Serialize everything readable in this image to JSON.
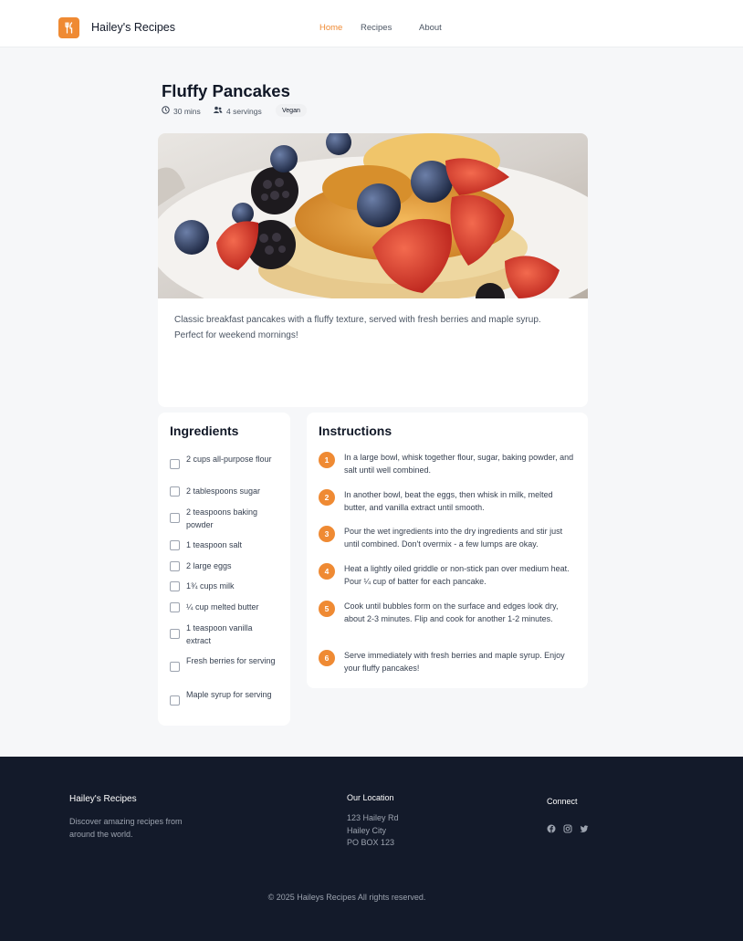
{
  "header": {
    "brand": "Hailey's Recipes",
    "nav": [
      "Home",
      "Recipes",
      "About"
    ],
    "accent_color": "#ef8a33",
    "logo_icon": "fork-knife-icon"
  },
  "recipe": {
    "title": "Fluffy Pancakes",
    "time": "30 mins",
    "servings": "4 servings",
    "tag": "Vegan",
    "description": "Classic breakfast pancakes with a fluffy texture, served with fresh berries and maple syrup. Perfect for weekend mornings!"
  },
  "ingredients": {
    "heading": "Ingredients",
    "items": [
      "2 cups all-purpose flour",
      "2 tablespoons sugar",
      "2 teaspoons baking powder",
      "1 teaspoon salt",
      "2 large eggs",
      "1¾ cups milk",
      "¼ cup melted butter",
      "1 teaspoon vanilla extract",
      "Fresh berries for serving",
      "Maple syrup for serving"
    ]
  },
  "instructions": {
    "heading": "Instructions",
    "steps": [
      {
        "num": "1",
        "text": "In a large bowl, whisk together flour, sugar, baking powder, and salt until well combined."
      },
      {
        "num": "2",
        "text": "In another bowl, beat the eggs, then whisk in milk, melted butter, and vanilla extract until smooth."
      },
      {
        "num": "3",
        "text": "Pour the wet ingredients into the dry ingredients and stir just until combined. Don't overmix - a few lumps are okay."
      },
      {
        "num": "4",
        "text": "Heat a lightly oiled griddle or non-stick pan over medium heat. Pour ¼ cup of batter for each pancake."
      },
      {
        "num": "5",
        "text": "Cook until bubbles form on the surface and edges look dry, about 2-3 minutes. Flip and cook for another 1-2 minutes."
      },
      {
        "num": "6",
        "text": "Serve immediately with fresh berries and maple syrup. Enjoy your fluffy pancakes!"
      }
    ]
  },
  "footer": {
    "brand": "Hailey's Recipes",
    "tagline": "Discover amazing recipes from around the world.",
    "location_title": "Our Location",
    "address": [
      "123 Hailey Rd",
      "Hailey City",
      "PO BOX 123"
    ],
    "connect_title": "Connect",
    "social_icons": [
      "facebook-icon",
      "instagram-icon",
      "twitter-icon"
    ],
    "copyright": "© 2025 Haileys Recipes All rights reserved."
  }
}
